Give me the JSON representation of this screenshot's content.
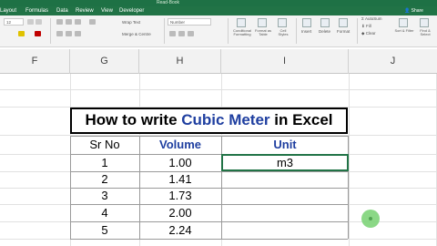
{
  "window": {
    "document_title": "Read-Book"
  },
  "tabs": [
    "Layout",
    "Formulas",
    "Data",
    "Review",
    "View",
    "Developer"
  ],
  "share_label": "Share",
  "ribbon": {
    "font_size": "12",
    "wrap_text": "Wrap Text",
    "merge_center": "Merge & Centre",
    "number_format": "Number",
    "conditional_formatting": "Conditional Formatting",
    "format_as_table": "Format as Table",
    "cell_styles": "Cell Styles",
    "insert": "Insert",
    "delete": "Delete",
    "format": "Format",
    "autosum": "AutoSum",
    "fill": "Fill",
    "clear": "Clear",
    "sort_filter": "Sort & Filter",
    "find_select": "Find & Select"
  },
  "columns": [
    "F",
    "G",
    "H",
    "I",
    "J"
  ],
  "sheet": {
    "title_prefix": "How to write ",
    "title_highlight": "Cubic Meter",
    "title_suffix": " in Excel",
    "headers": [
      "Sr No",
      "Volume",
      "Unit"
    ],
    "rows": [
      {
        "sr": "1",
        "volume": "1.00",
        "unit": "m3"
      },
      {
        "sr": "2",
        "volume": "1.41",
        "unit": ""
      },
      {
        "sr": "3",
        "volume": "1.73",
        "unit": ""
      },
      {
        "sr": "4",
        "volume": "2.00",
        "unit": ""
      },
      {
        "sr": "5",
        "volume": "2.24",
        "unit": ""
      }
    ]
  },
  "colors": {
    "accent": "#217346",
    "header_text": "#1f3fa0",
    "title_highlight": "#1f3fa0"
  }
}
